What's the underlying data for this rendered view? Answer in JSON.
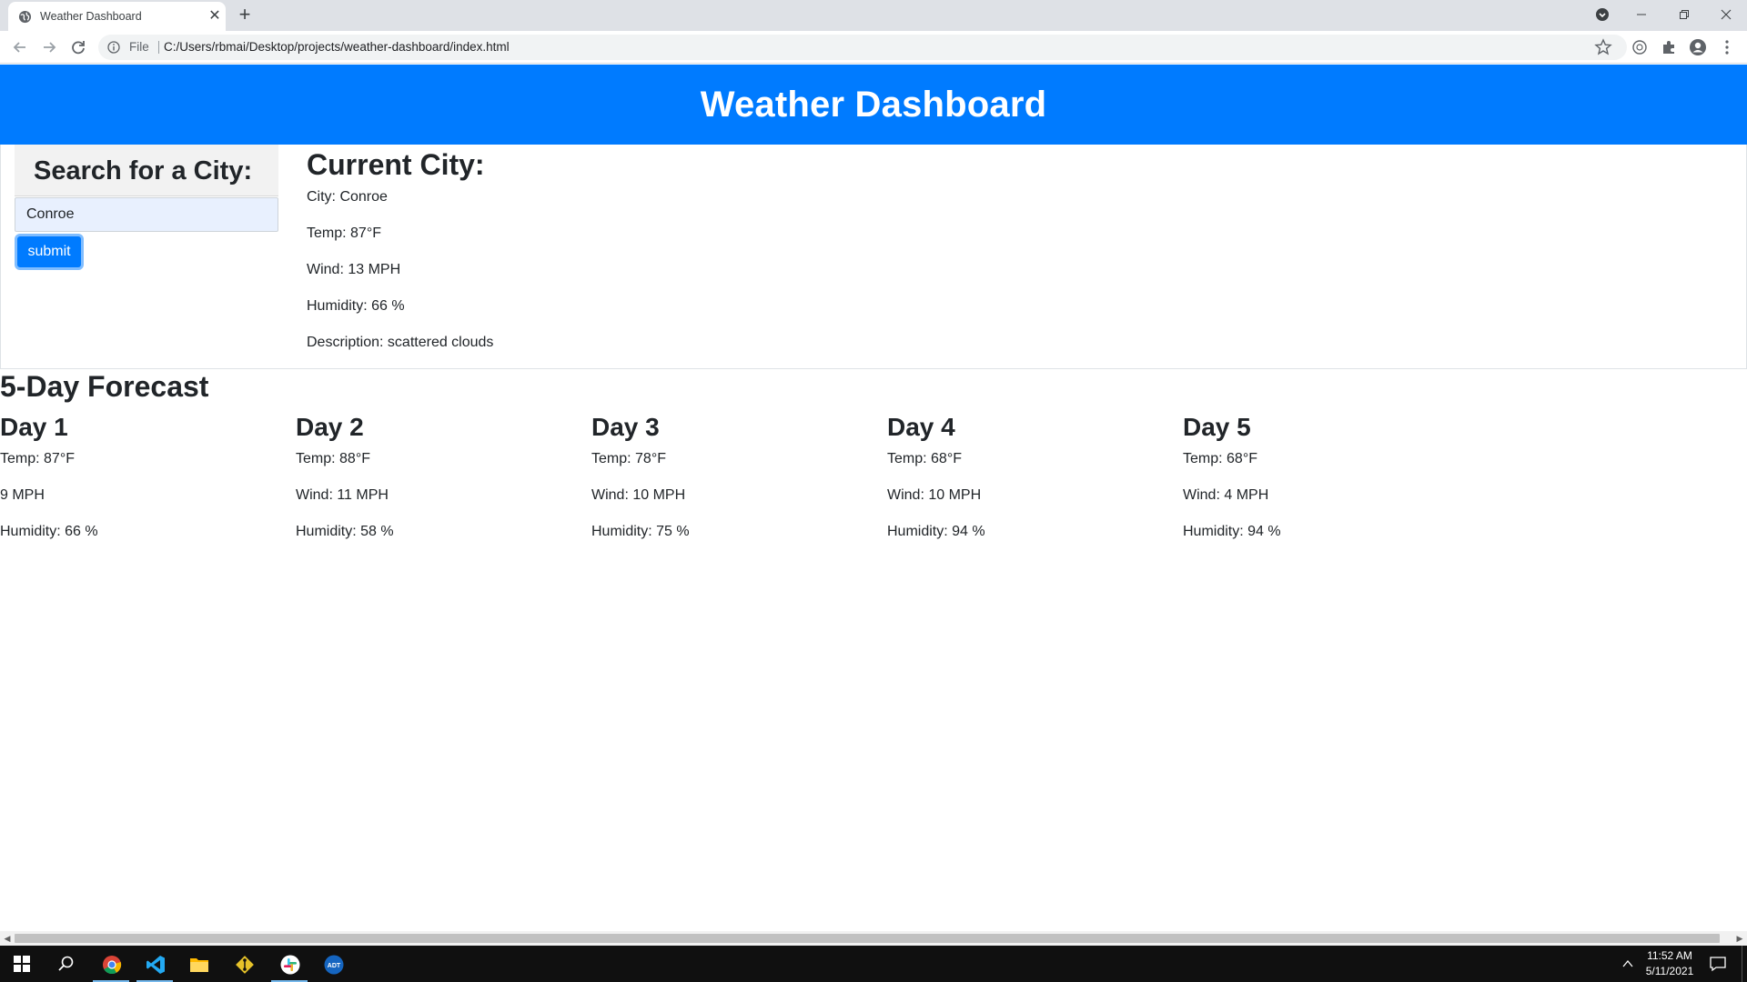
{
  "browser": {
    "tab_title": "Weather Dashboard",
    "scheme_label": "File",
    "url": "C:/Users/rbmai/Desktop/projects/weather-dashboard/index.html"
  },
  "header": {
    "title": "Weather Dashboard"
  },
  "search": {
    "heading": "Search for a City:",
    "input_value": "Conroe",
    "submit_label": "submit"
  },
  "current": {
    "heading": "Current City:",
    "city": "City: Conroe",
    "temp": "Temp: 87°F",
    "wind": "Wind: 13 MPH",
    "humidity": "Humidity: 66 %",
    "description": "Description: scattered clouds"
  },
  "forecast": {
    "heading": "5-Day Forecast",
    "days": [
      {
        "label": "Day 1",
        "temp": "Temp: 87°F",
        "wind": "9 MPH",
        "humidity": "Humidity: 66 %"
      },
      {
        "label": "Day 2",
        "temp": "Temp: 88°F",
        "wind": "Wind: 11 MPH",
        "humidity": "Humidity: 58 %"
      },
      {
        "label": "Day 3",
        "temp": "Temp: 78°F",
        "wind": "Wind: 10 MPH",
        "humidity": "Humidity: 75 %"
      },
      {
        "label": "Day 4",
        "temp": "Temp: 68°F",
        "wind": "Wind: 10 MPH",
        "humidity": "Humidity: 94 %"
      },
      {
        "label": "Day 5",
        "temp": "Temp: 68°F",
        "wind": "Wind: 4 MPH",
        "humidity": "Humidity: 94 %"
      }
    ]
  },
  "taskbar": {
    "time": "11:52 AM",
    "date": "5/11/2021",
    "apps": [
      "start-icon",
      "search-icon",
      "chrome-icon",
      "vscode-icon",
      "file-explorer-icon",
      "git-icon",
      "slack-icon",
      "adt-icon"
    ]
  },
  "colors": {
    "accent": "#007bff",
    "taskbar": "#101010",
    "chrome_tabstrip": "#dee1e6"
  }
}
